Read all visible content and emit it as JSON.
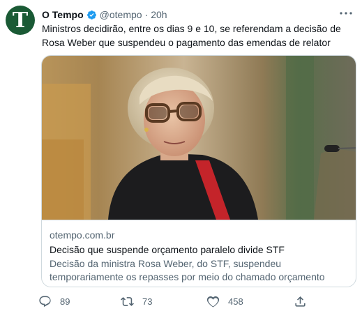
{
  "tweet": {
    "author": {
      "name": "O Tempo",
      "handle": "@otempo",
      "avatar_letter": "T",
      "avatar_color": "#1a5a35",
      "verified": true
    },
    "separator": "·",
    "time": "20h",
    "text": "Ministros decidirão, entre os dias 9 e 10, se referendam a decisão de Rosa Weber que suspendeu o pagamento das emendas de relator",
    "card": {
      "domain": "otempo.com.br",
      "title": "Decisão que suspende orçamento paralelo divide STF",
      "description": "Decisão da ministra Rosa Weber, do STF, suspendeu temporariamente os repasses por meio do chamado orçamento paralelo. Tema divide ..."
    },
    "actions": {
      "reply_count": "89",
      "retweet_count": "73",
      "like_count": "458"
    }
  },
  "colors": {
    "text_primary": "#0f1419",
    "text_secondary": "#536471",
    "verified_blue": "#1d9bf0",
    "border": "#cfd9de"
  }
}
